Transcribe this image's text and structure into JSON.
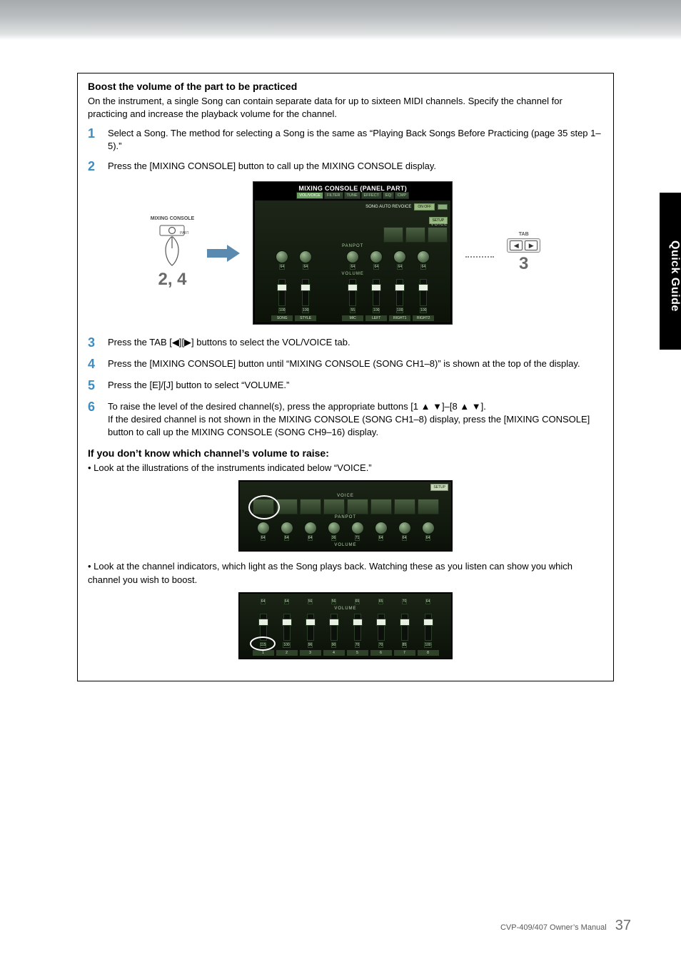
{
  "sidetab": "Quick Guide",
  "section": {
    "heading": "Boost the volume of the part to be practiced",
    "intro": "On the instrument, a single Song can contain separate data for up to sixteen MIDI channels. Specify the channel for practicing and increase the playback volume for the channel.",
    "steps": {
      "1": "Select a Song. The method for selecting a Song is the same as “Playing Back Songs Before Practicing (page 35 step 1–5).”",
      "2": "Press the [MIXING CONSOLE] button to call up the MIXING CONSOLE display.",
      "3": "Press the TAB [◀][▶] buttons to select the VOL/VOICE tab.",
      "4": "Press the [MIXING CONSOLE] button until “MIXING CONSOLE (SONG CH1–8)” is shown at the top of the display.",
      "5": "Press the [E]/[J] button to select “VOLUME.”",
      "6": "To raise the level of the desired channel(s), press the appropriate buttons [1 ▲ ▼]–[8 ▲ ▼].\nIf the desired channel is not shown in the MIXING CONSOLE (SONG CH1–8) display, press the [MIXING CONSOLE] button to call up the MIXING CONSOLE (SONG CH9–16) display."
    },
    "sub_heading": "If you don’t know which channel’s volume to raise:",
    "bullet1": "• Look at the illustrations of the instruments indicated below “VOICE.”",
    "bullet2": "• Look at the channel indicators, which light as the Song plays back. Watching these as you listen can show you which channel you wish to boost."
  },
  "figure": {
    "hand_label": "MIXING CONSOLE",
    "callout_24": "2, 4",
    "callout_3": "3",
    "tab_label": "TAB",
    "console": {
      "title": "MIXING CONSOLE (PANEL PART)",
      "tabs": [
        "VOL/VOICE",
        "FILTER",
        "TUNE",
        "EFFECT",
        "EQ",
        "CMP"
      ],
      "auto_revoice": "SONG AUTO REVOICE",
      "on_off": "ON\nOFF",
      "setup": "SETUP",
      "row_voice": "VOICE",
      "row_panpot": "PANPOT",
      "row_volume": "VOLUME",
      "knob_vals": [
        "64",
        "64",
        "",
        "64",
        "64",
        "64",
        "64"
      ],
      "fader_vals": [
        "100",
        "100",
        "",
        "55",
        "100",
        "100",
        "100"
      ],
      "footer": [
        "SONG",
        "STYLE",
        "",
        "MIC",
        "LEFT",
        "RIGHT1",
        "RIGHT2"
      ]
    }
  },
  "voice_strip": {
    "setup": "SETUP",
    "label_voice": "VOICE",
    "label_panpot": "PANPOT",
    "label_volume": "VOLUME",
    "knob_vals": [
      "64",
      "64",
      "64",
      "36",
      "71",
      "64",
      "64",
      "64"
    ]
  },
  "volume_strip": {
    "label": "VOLUME",
    "top_vals": [
      "64",
      "64",
      "56",
      "56",
      "65",
      "65",
      "70",
      "64"
    ],
    "bot_vals": [
      "115",
      "100",
      "96",
      "90",
      "70",
      "70",
      "85",
      "100"
    ],
    "footer": [
      "1",
      "2",
      "3",
      "4",
      "5",
      "6",
      "7",
      "8"
    ]
  },
  "footer": {
    "manual": "CVP-409/407 Owner’s Manual",
    "page": "37"
  }
}
